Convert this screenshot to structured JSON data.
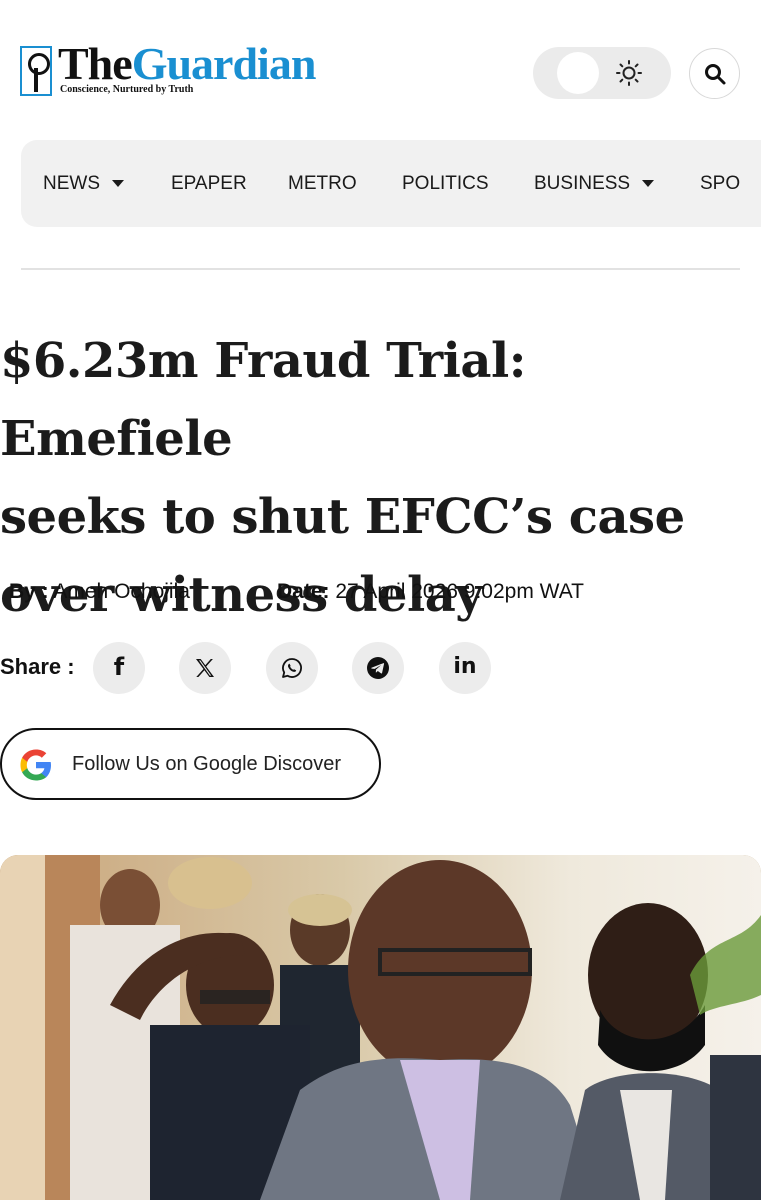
{
  "header": {
    "logo": {
      "the": "The",
      "guardian": "Guardian",
      "tagline": "Conscience, Nurtured by Truth"
    },
    "theme_toggle_icon": "sun-icon",
    "search_icon": "search-icon"
  },
  "nav": {
    "items": [
      {
        "label": "NEWS",
        "has_dropdown": true
      },
      {
        "label": "EPAPER",
        "has_dropdown": false
      },
      {
        "label": "METRO",
        "has_dropdown": false
      },
      {
        "label": "POLITICS",
        "has_dropdown": false
      },
      {
        "label": "BUSINESS",
        "has_dropdown": true
      },
      {
        "label": "SPO",
        "has_dropdown": false
      }
    ]
  },
  "article": {
    "headline_lines": [
      "$6.23m Fraud Trial: Emefiele",
      "seeks to shut EFCC’s case",
      "over witness delay"
    ],
    "by_label": "By :",
    "author": "Ameh Ochojila",
    "date_label": "Date:",
    "date": "27 April 2026 9:02pm WAT",
    "share_label": "Share :",
    "share_buttons": [
      {
        "name": "facebook",
        "glyph": "f"
      },
      {
        "name": "x",
        "glyph": "X"
      },
      {
        "name": "whatsapp",
        "glyph": ""
      },
      {
        "name": "telegram",
        "glyph": ""
      },
      {
        "name": "linkedin",
        "glyph": "in"
      }
    ],
    "discover_label": "Follow Us on Google Discover"
  },
  "colors": {
    "brand_blue": "#1a8fd1",
    "nav_bg": "#f1f1f1",
    "share_bg": "#ececec"
  }
}
